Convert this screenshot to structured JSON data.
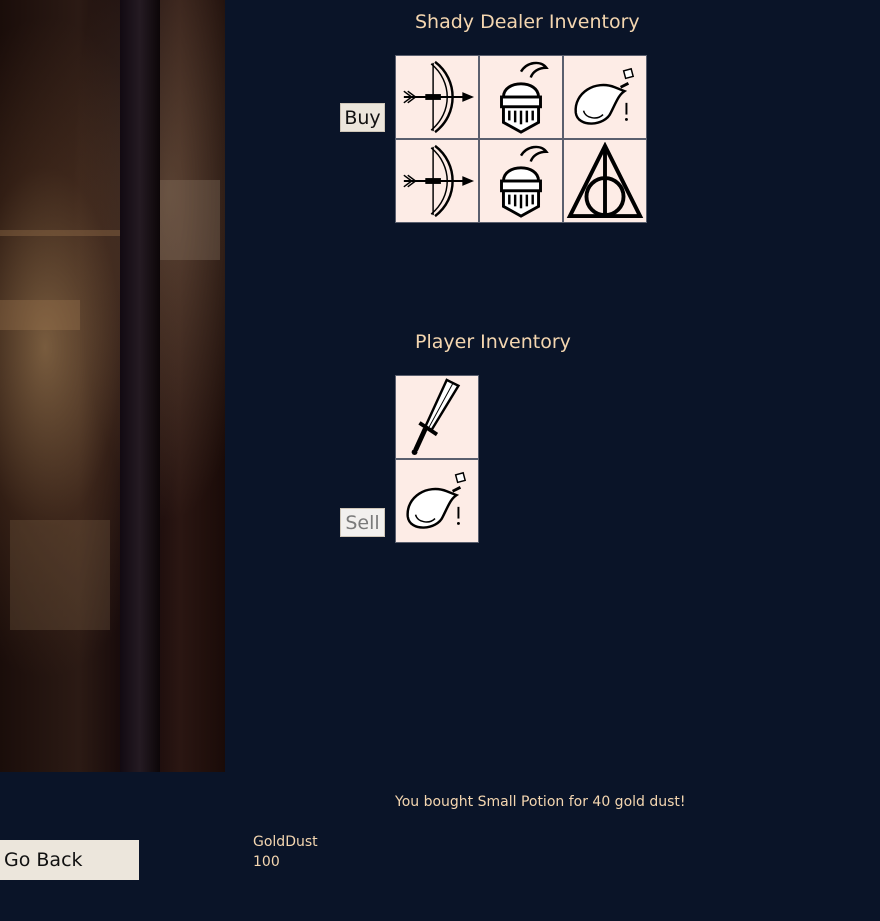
{
  "dealer": {
    "title": "Shady Dealer Inventory",
    "buy_label": "Buy",
    "items": [
      "bow-icon",
      "knight-helmet-icon",
      "potion-icon",
      "bow-icon",
      "knight-helmet-icon",
      "deathly-hallows-icon"
    ]
  },
  "player": {
    "title": "Player Inventory",
    "sell_label": "Sell",
    "items": [
      "sword-icon",
      "potion-icon"
    ]
  },
  "message": "You bought Small Potion for 40 gold dust!",
  "gold": {
    "label": "GoldDust",
    "value": "100"
  },
  "back_label": "Go Back",
  "colors": {
    "background": "#0a1428",
    "text_accent": "#f4d6b0",
    "slot_bg": "#fdece6",
    "button_bg": "#ece6dc"
  }
}
